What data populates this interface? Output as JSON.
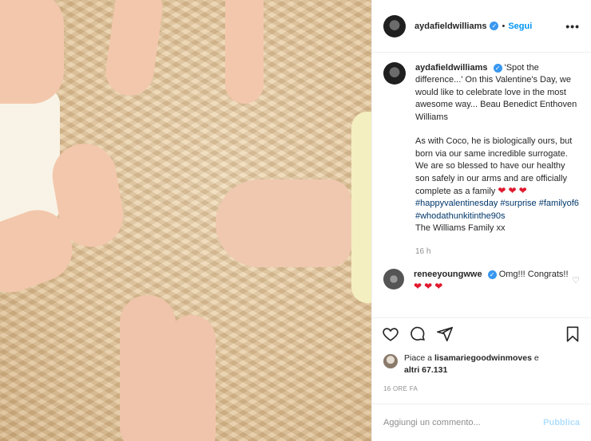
{
  "photo": {
    "description_icon": "photo-image"
  },
  "header": {
    "username": "aydafieldwilliams",
    "separator": "•",
    "follow_label": "Segui",
    "more_label": "•••"
  },
  "caption": {
    "username": "aydafieldwilliams",
    "text_1": "'Spot the difference...' On this Valentine's Day, we would like to celebrate love in the most awesome way... Beau Benedict Enthoven Williams",
    "text_2": "As with Coco, he is biologically ours, but born via our same incredible surrogate. We are so blessed to have our healthy son safely in our arms and are officially complete as a family",
    "hashtag_1": "#happyvalentinesday",
    "hashtag_2": "#surprise",
    "hashtag_3": "#familyof6",
    "hashtag_4": "#whodathunkitinthe90s",
    "signature": "The Williams Family xx",
    "time": "16 h",
    "heart": "❤"
  },
  "reply": {
    "username": "reneeyoungwwe",
    "text": "Omg!!! Congrats!!",
    "heart": "❤"
  },
  "likes": {
    "prefix": "Piace a",
    "username": "lisamariegoodwinmoves",
    "conjunction": "e",
    "others": "altri 67.131"
  },
  "date": "16 ORE FA",
  "comment_input": {
    "placeholder": "Aggiungi un commento...",
    "value": ""
  },
  "publish_label": "Pubblica",
  "colors": {
    "accent": "#0095f6",
    "publish_disabled": "#b2dffc",
    "muted": "#8e8e8e",
    "heart": "#e0192e"
  }
}
